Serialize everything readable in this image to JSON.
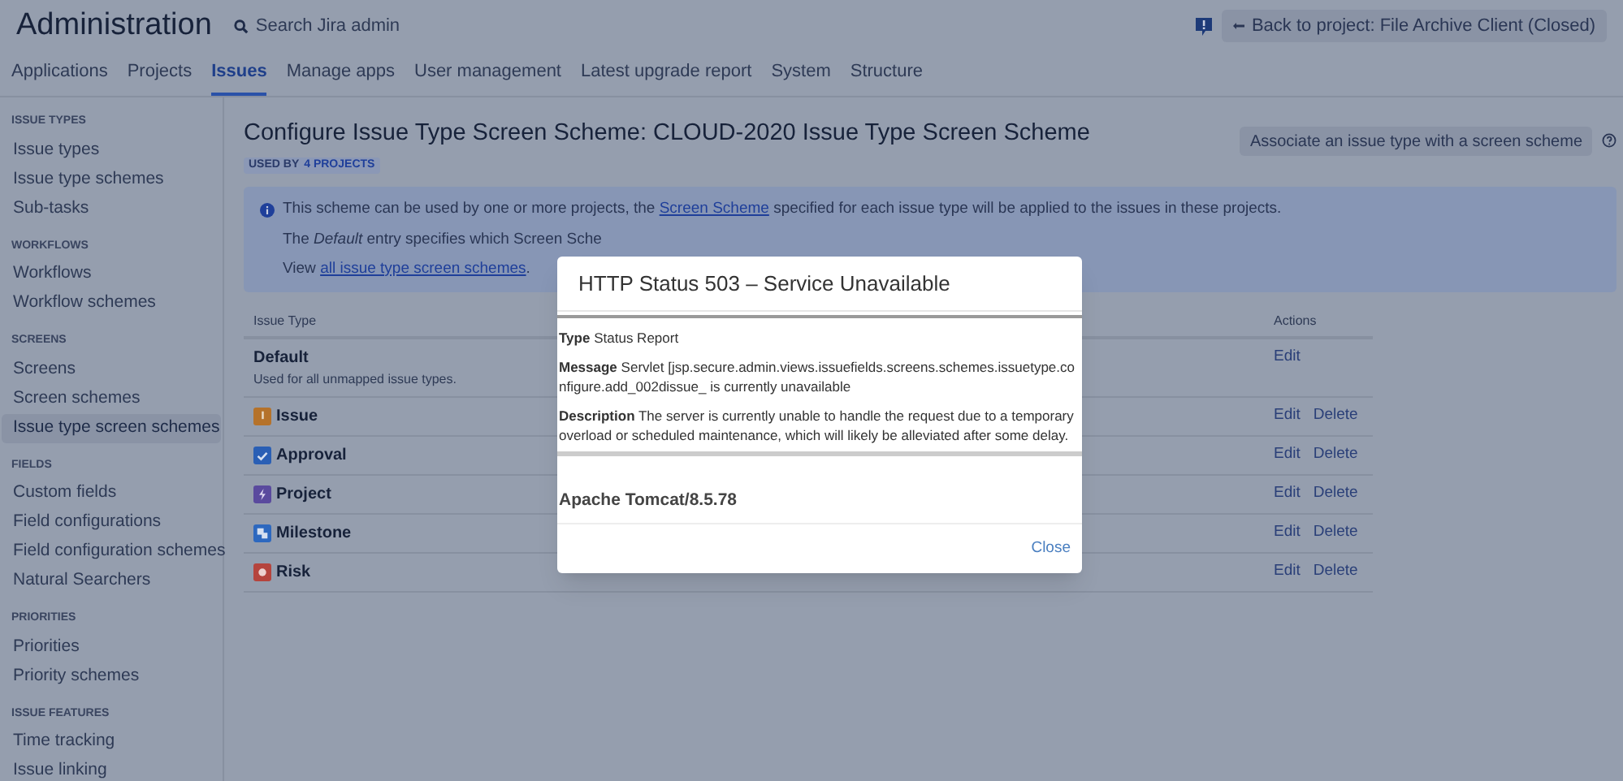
{
  "header": {
    "title": "Administration",
    "search": {
      "placeholder": "Search Jira admin"
    },
    "back_button": "Back to project: File Archive Client (Closed)"
  },
  "tabs": [
    {
      "label": "Applications",
      "selected": false
    },
    {
      "label": "Projects",
      "selected": false
    },
    {
      "label": "Issues",
      "selected": true
    },
    {
      "label": "Manage apps",
      "selected": false
    },
    {
      "label": "User management",
      "selected": false
    },
    {
      "label": "Latest upgrade report",
      "selected": false
    },
    {
      "label": "System",
      "selected": false
    },
    {
      "label": "Structure",
      "selected": false
    }
  ],
  "sidebar": {
    "sections": [
      {
        "heading": "ISSUE TYPES",
        "items": [
          {
            "label": "Issue types",
            "selected": false
          },
          {
            "label": "Issue type schemes",
            "selected": false
          },
          {
            "label": "Sub-tasks",
            "selected": false
          }
        ]
      },
      {
        "heading": "WORKFLOWS",
        "items": [
          {
            "label": "Workflows",
            "selected": false
          },
          {
            "label": "Workflow schemes",
            "selected": false
          }
        ]
      },
      {
        "heading": "SCREENS",
        "items": [
          {
            "label": "Screens",
            "selected": false
          },
          {
            "label": "Screen schemes",
            "selected": false
          },
          {
            "label": "Issue type screen schemes",
            "selected": true
          }
        ]
      },
      {
        "heading": "FIELDS",
        "items": [
          {
            "label": "Custom fields",
            "selected": false
          },
          {
            "label": "Field configurations",
            "selected": false
          },
          {
            "label": "Field configuration schemes",
            "selected": false
          },
          {
            "label": "Natural Searchers",
            "selected": false
          }
        ]
      },
      {
        "heading": "PRIORITIES",
        "items": [
          {
            "label": "Priorities",
            "selected": false
          },
          {
            "label": "Priority schemes",
            "selected": false
          }
        ]
      },
      {
        "heading": "ISSUE FEATURES",
        "items": [
          {
            "label": "Time tracking",
            "selected": false
          },
          {
            "label": "Issue linking",
            "selected": false
          }
        ]
      }
    ]
  },
  "page": {
    "title": "Configure Issue Type Screen Scheme: CLOUD-2020 Issue Type Screen Scheme",
    "badge_prefix": "USED BY",
    "badge_link": "4 PROJECTS",
    "associate_button": "Associate an issue type with a screen scheme",
    "info": {
      "line_1_before": "This scheme can be used by one or more projects, the",
      "line_1_link": "Screen Scheme",
      "line_1_after": "specified for each issue type will be applied to the issues in these projects.",
      "line_2": "The *Default* entry specifies which Screen Sche",
      "line_3_before": "View",
      "line_3_link": "all issue type screen schemes",
      "line_3_after": "."
    },
    "table": {
      "columns": [
        "Issue Type",
        "Actions"
      ],
      "rows": [
        {
          "name": "Default",
          "description": "Used for all unmapped issue types.",
          "actions": [
            "Edit"
          ]
        },
        {
          "name": "Issue",
          "kind": "warning",
          "color": "#b5722a",
          "actions": [
            "Edit",
            "Delete"
          ]
        },
        {
          "name": "Approval",
          "kind": "check",
          "color": "#2a5fb5",
          "actions": [
            "Edit",
            "Delete"
          ]
        },
        {
          "name": "Project",
          "kind": "bolt",
          "color": "#5a4a9e",
          "actions": [
            "Edit",
            "Delete"
          ]
        },
        {
          "name": "Milestone",
          "kind": "squares",
          "color": "#2d68bf",
          "actions": [
            "Edit",
            "Delete"
          ]
        },
        {
          "name": "Risk",
          "kind": "circle",
          "color": "#b5443d",
          "actions": [
            "Edit",
            "Delete"
          ]
        }
      ]
    }
  },
  "dialog": {
    "title": "HTTP Status 503 – Service Unavailable",
    "type_label": "Type",
    "type_value": "Status Report",
    "message_label": "Message",
    "message_value": "Servlet [jsp.secure.admin.views.issuefields.screens.schemes.issuetype.configure.add_002dissue_ is currently unavailable",
    "description_label": "Description",
    "description_value": "The server is currently unable to handle the request due to a temporary overload or scheduled maintenance, which will likely be alleviated after some delay.",
    "server": "Apache Tomcat/8.5.78",
    "close": "Close"
  }
}
